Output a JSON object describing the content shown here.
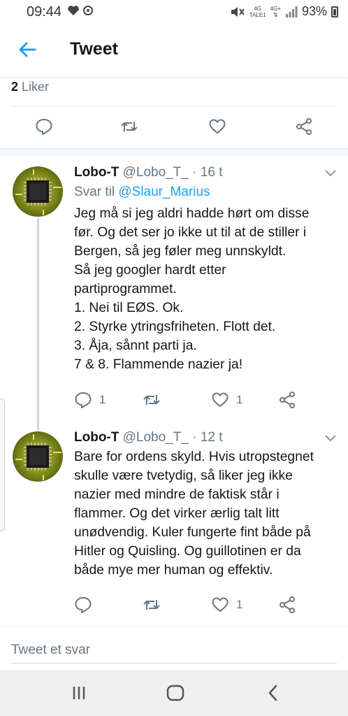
{
  "status_bar": {
    "time": "09:44",
    "net1": "4G",
    "net1_sub": "TALE1",
    "net2": "4G+",
    "battery_percent": "93%"
  },
  "header": {
    "title": "Tweet"
  },
  "main_tweet": {
    "like_count": "2",
    "like_label": "Liker"
  },
  "replies": [
    {
      "name": "Lobo-T",
      "handle": "@Lobo_T_",
      "age": "16 t",
      "reply_to_label": "Svar til",
      "reply_to_handle": "@Slaur_Marius",
      "lines": [
        "Jeg må si jeg aldri hadde hørt om disse",
        "før.  Og det ser jo ikke ut til at de stiller i",
        "Bergen, så jeg føler meg unnskyldt.",
        "Så jeg googler hardt etter",
        "partiprogrammet.",
        "1. Nei til EØS.  Ok.",
        "2. Styrke ytringsfriheten.  Flott det.",
        "3. Åja, sånnt parti ja.",
        "7 & 8.  Flammende nazier ja!"
      ],
      "reply_count": "1",
      "retweet_count": "",
      "like_count": "1"
    },
    {
      "name": "Lobo-T",
      "handle": "@Lobo_T_",
      "age": "12 t",
      "lines": [
        "Bare for ordens skyld.  Hvis utropstegnet",
        "skulle være tvetydig, så liker jeg ikke",
        "nazier med mindre de faktisk står i",
        "flammer.  Og det virker ærlig talt litt",
        "unødvendig.  Kuler fungerte fint både på",
        "Hitler og Quisling.  Og guillotinen er da",
        "både mye mer human og effektiv."
      ],
      "reply_count": "",
      "retweet_count": "",
      "like_count": "1"
    }
  ],
  "reply_box": {
    "placeholder": "Tweet et svar"
  },
  "colors": {
    "accent": "#1da1f2",
    "text": "#14171a",
    "muted": "#657786",
    "divider": "#e6ecf0"
  },
  "icons": [
    "back-arrow-icon",
    "reply-icon",
    "retweet-icon",
    "heart-icon",
    "share-icon",
    "chevron-down-icon",
    "recents-icon",
    "home-icon",
    "back-nav-icon"
  ]
}
